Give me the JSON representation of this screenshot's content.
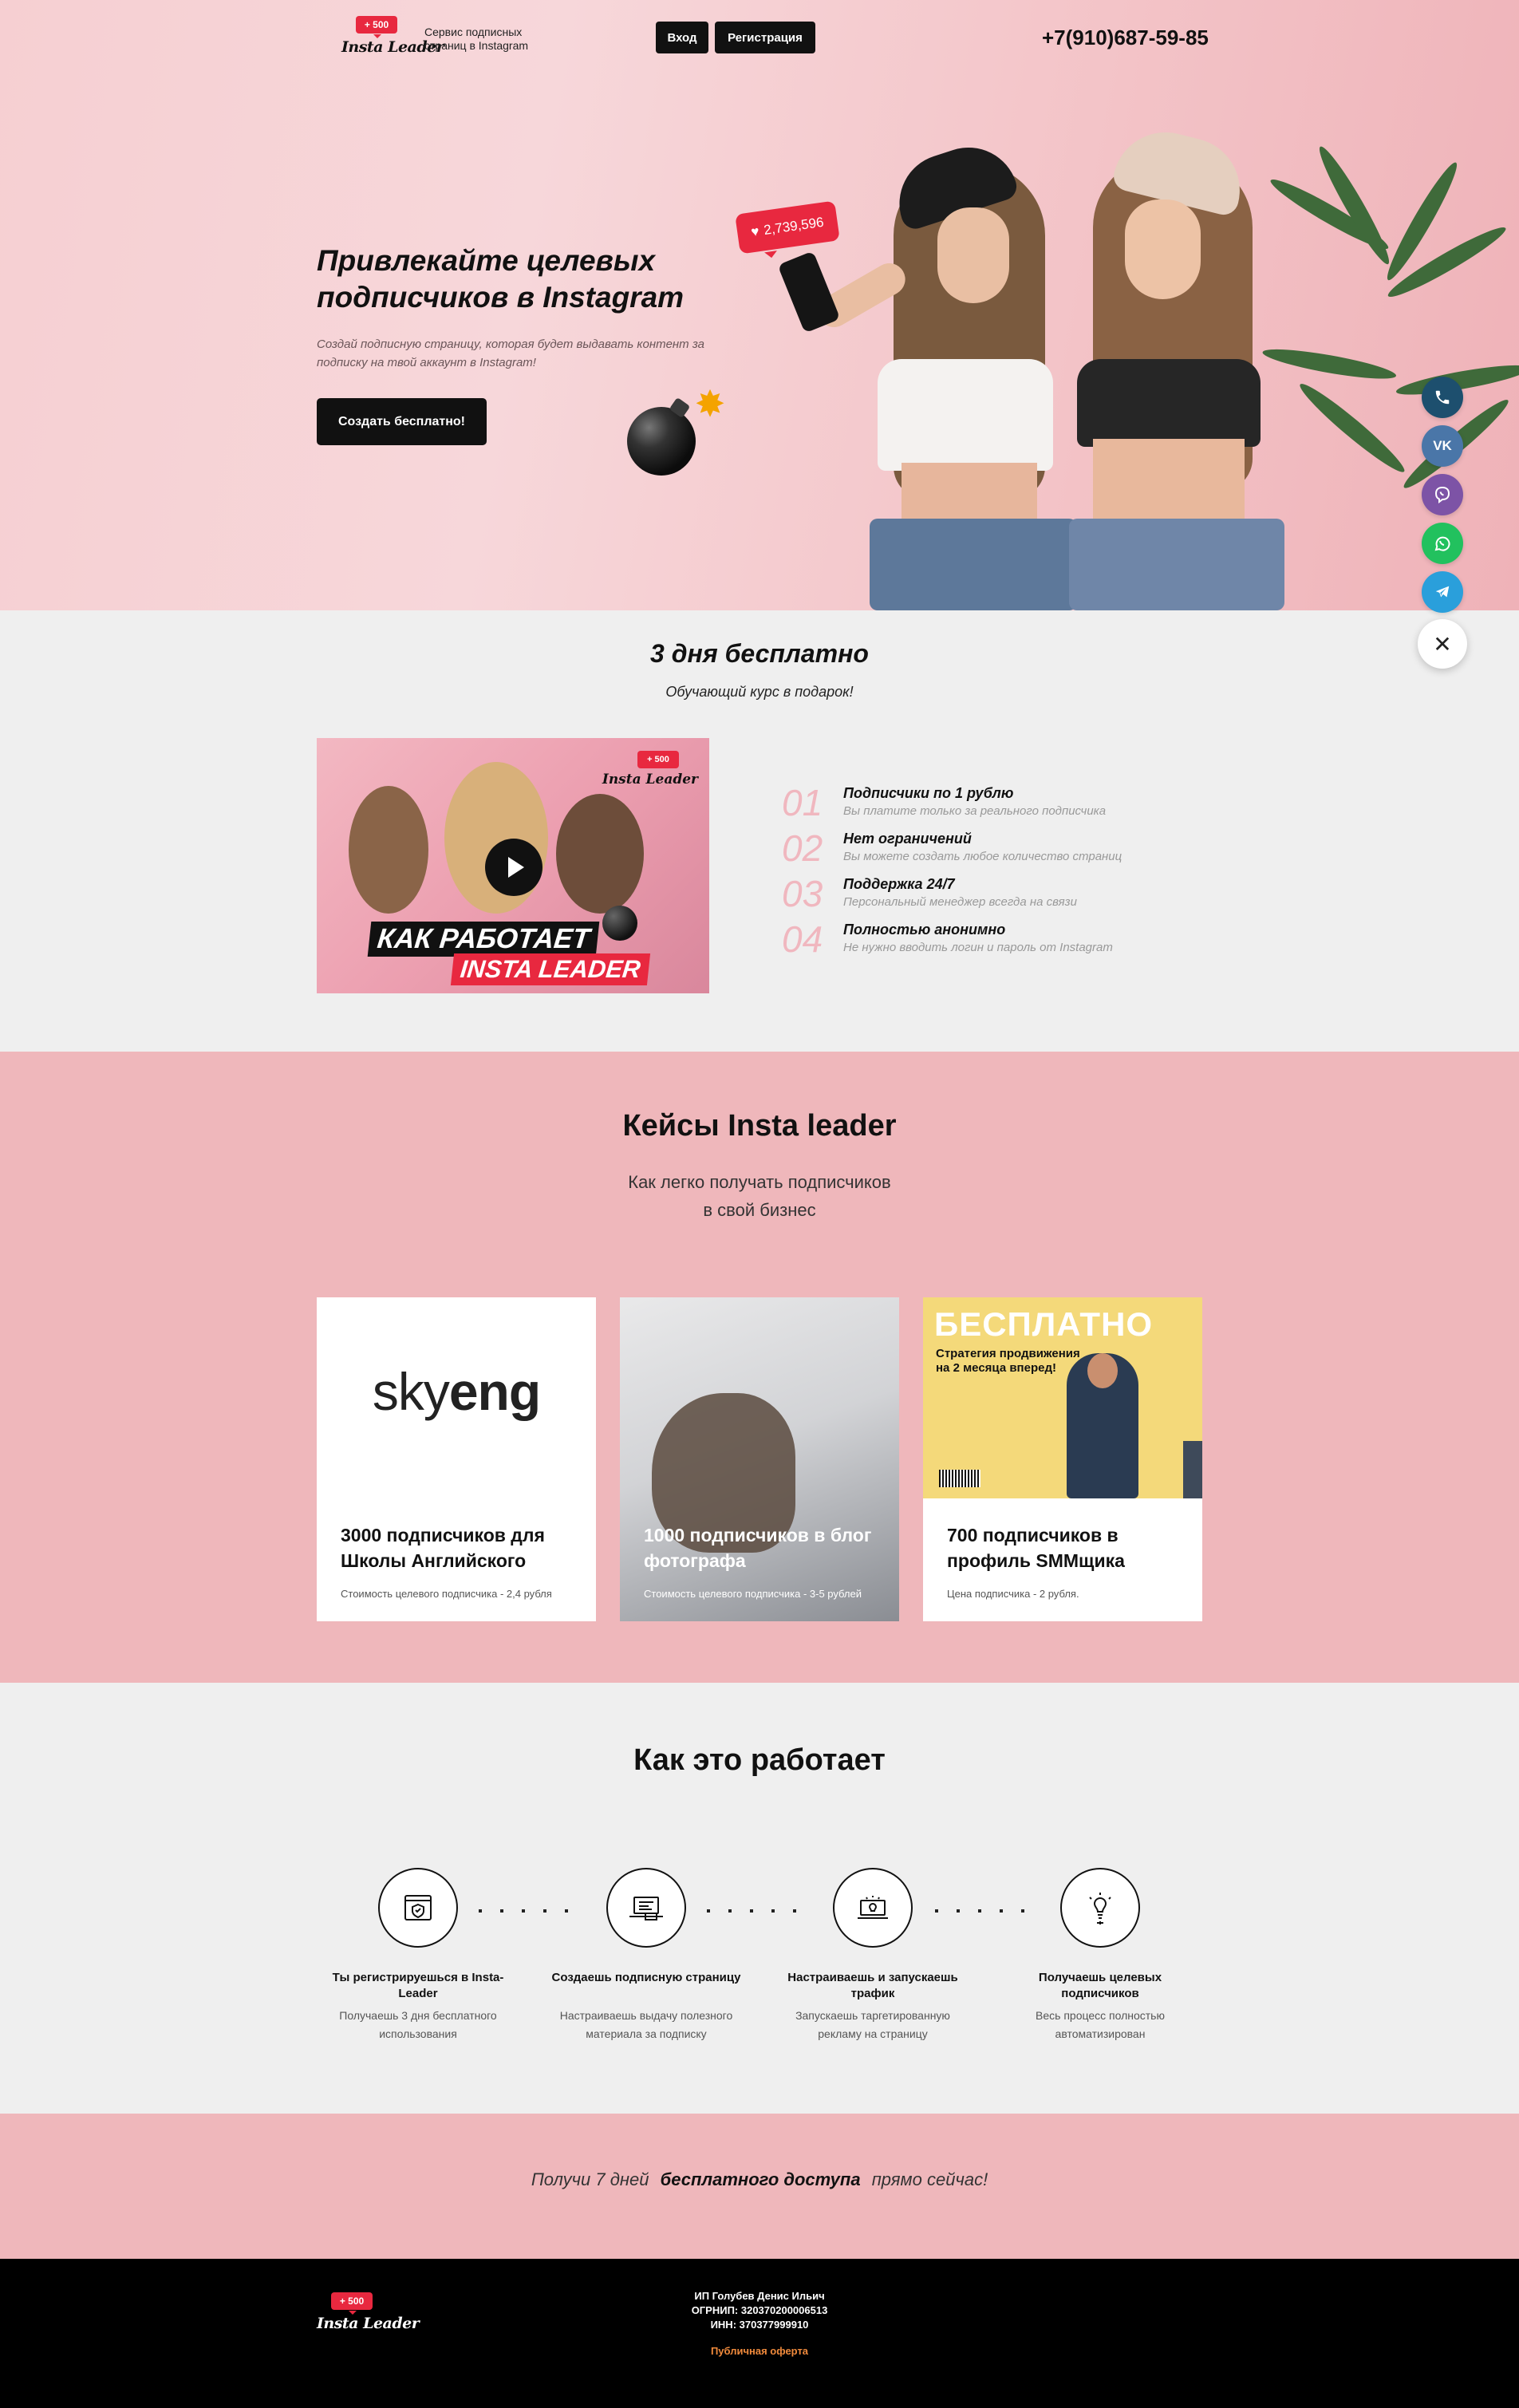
{
  "header": {
    "logo_badge": "+ 500",
    "logo_text": "Insta Leader",
    "description": "Сервис подписных страниц в Instagram",
    "login_label": "Вход",
    "register_label": "Регистрация",
    "phone": "+7(910)687-59-85"
  },
  "hero": {
    "title": "Привлекайте целевых подписчиков в Instagram",
    "subtitle": "Создай подписную страницу, которая будет выдавать контент за подписку на твой аккаунт в Instagram!",
    "cta_label": "Создать бесплатно!",
    "likes_count": "2,739,596"
  },
  "contacts": {
    "icons": [
      "phone-icon",
      "vk-icon",
      "viber-icon",
      "whatsapp-icon",
      "telegram-icon",
      "close-icon"
    ],
    "vk_label": "VK"
  },
  "free": {
    "title": "3 дня бесплатно",
    "subtitle": "Обучающий курс в подарок!",
    "video": {
      "badge": "+ 500",
      "brand": "Insta Leader",
      "caption_line1": "КАК РАБОТАЕТ",
      "caption_line2": "INSTA LEADER"
    },
    "features": [
      {
        "num": "01",
        "title": "Подписчики по 1 рублю",
        "desc": "Вы платите только за реального подписчика"
      },
      {
        "num": "02",
        "title": "Нет ограничений",
        "desc": "Вы можете создать любое количество страниц"
      },
      {
        "num": "03",
        "title": "Поддержка 24/7",
        "desc": "Персональный менеджер всегда на связи"
      },
      {
        "num": "04",
        "title": "Полностью анонимно",
        "desc": "Не нужно вводить логин и пароль от Instagram"
      }
    ]
  },
  "cases": {
    "title": "Кейсы Insta leader",
    "subtitle_line1": "Как легко получать подписчиков",
    "subtitle_line2": "в свой бизнес",
    "items": [
      {
        "logo_a": "sky",
        "logo_b": "eng",
        "title": "3000 подписчиков для Школы Английского",
        "note": "Стоимость целевого подписчика - 2,4 рубля"
      },
      {
        "title": "1000 подписчиков в блог фотографа",
        "note": "Стоимость целевого подписчика - 3-5 рублей"
      },
      {
        "poster_big": "БЕСПЛАТНО",
        "poster_sub": "Стратегия продвижения на 2 месяца вперед!",
        "title": "700 подписчиков в профиль SMMщика",
        "note": "Цена подписчика - 2 рубля."
      }
    ]
  },
  "how": {
    "title": "Как это работает",
    "steps": [
      {
        "icon": "shield-icon",
        "title": "Ты регистрируешься в Insta-Leader",
        "desc": "Получаешь 3 дня бесплатного использования"
      },
      {
        "icon": "laptop-icon",
        "title": "Создаешь подписную страницу",
        "desc": "Настраиваешь выдачу полезного материала за подписку"
      },
      {
        "icon": "target-icon",
        "title": "Настраиваешь и запускаешь трафик",
        "desc": "Запускаешь таргетированную рекламу на страницу"
      },
      {
        "icon": "lightbulb-icon",
        "title": "Получаешь целевых подписчиков",
        "desc": "Весь процесс полностью автоматизирован"
      }
    ]
  },
  "cta": {
    "before": "Получи 7 дней",
    "bold": "бесплатного доступа",
    "after": "прямо сейчас!"
  },
  "footer": {
    "logo_badge": "+ 500",
    "logo_text": "Insta Leader",
    "owner": "ИП Голубев Денис Ильич",
    "ogrnip": "ОГРНИП: 320370200006513",
    "inn": "ИНН: 370377999910",
    "offer_label": "Публичная оферта"
  }
}
